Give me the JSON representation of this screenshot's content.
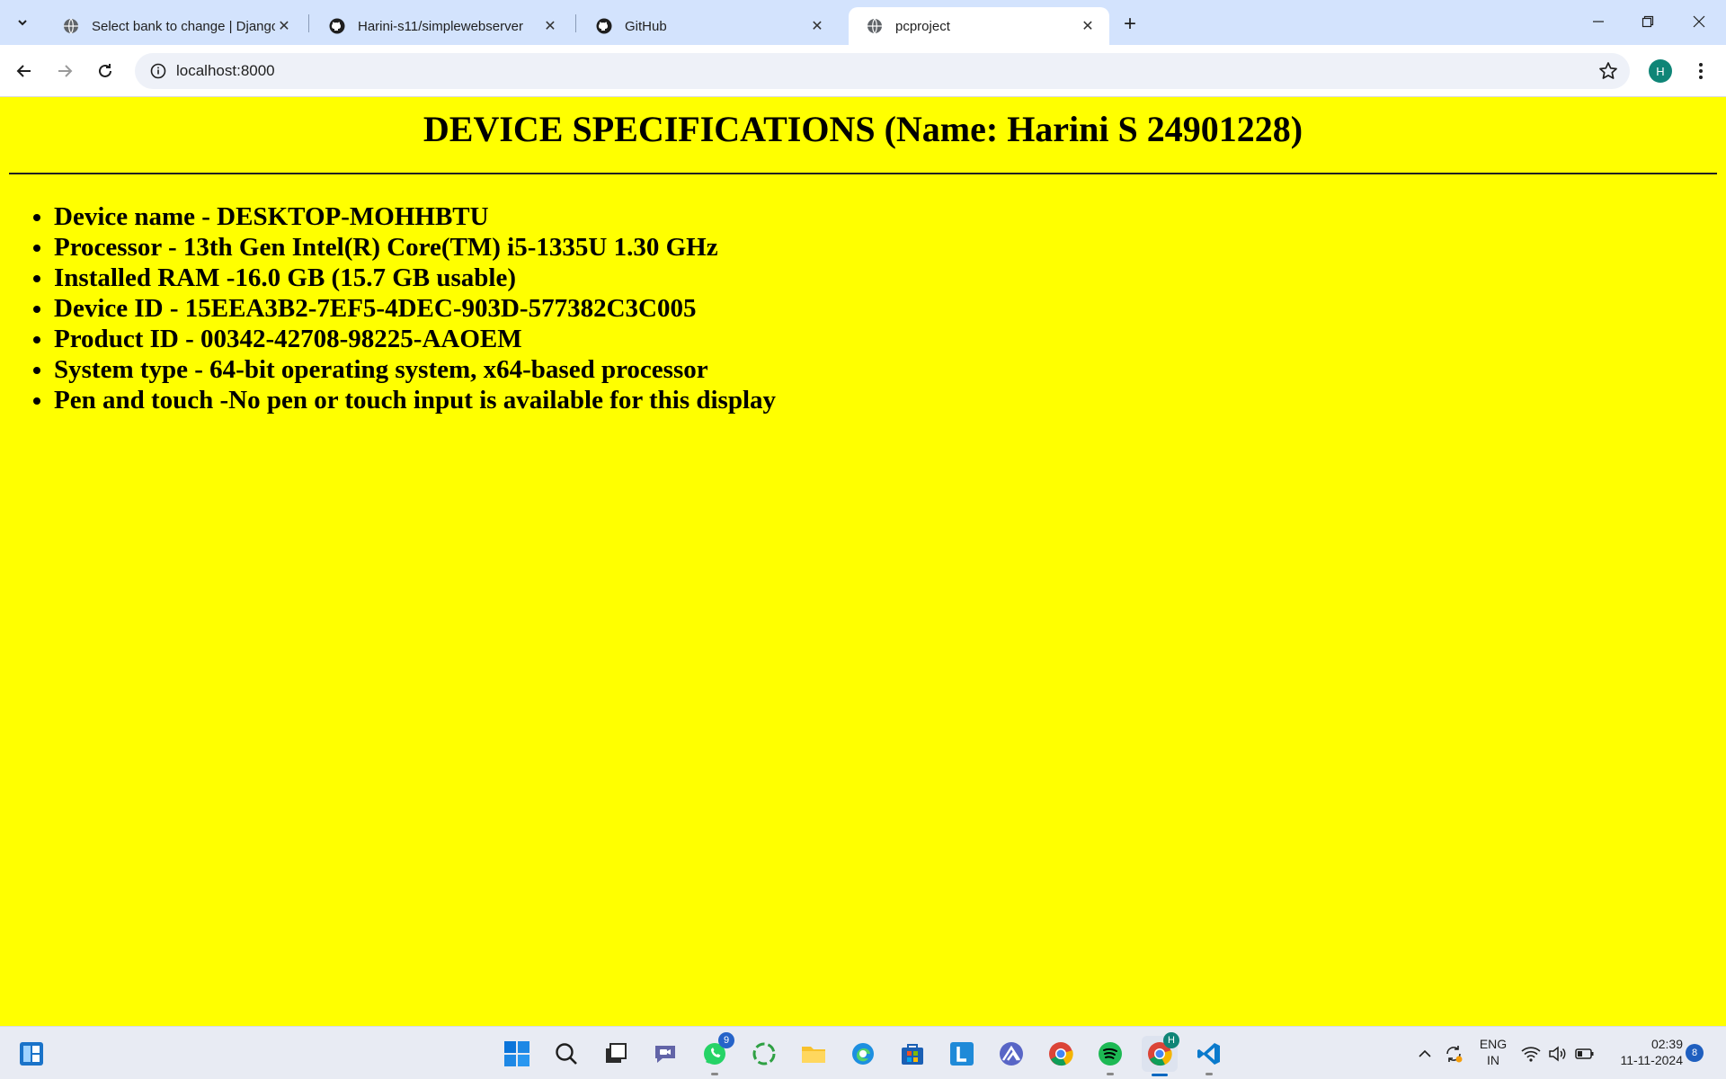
{
  "browser": {
    "tabs": [
      {
        "title": "Select bank to change | Django",
        "favicon": "globe-icon",
        "active": false
      },
      {
        "title": "Harini-s11/simplewebserver",
        "favicon": "github-icon",
        "active": false
      },
      {
        "title": "GitHub",
        "favicon": "github-icon",
        "active": false
      },
      {
        "title": "pcproject",
        "favicon": "globe-icon",
        "active": true
      }
    ],
    "url": "localhost:8000",
    "profile_initial": "H"
  },
  "page": {
    "heading": "DEVICE SPECIFICATIONS (Name: Harini S 24901228)",
    "specs": [
      "Device name - DESKTOP-MOHHBTU",
      "Processor - 13th Gen Intel(R) Core(TM) i5-1335U 1.30 GHz",
      "Installed RAM -16.0 GB (15.7 GB usable)",
      "Device ID - 15EEA3B2-7EF5-4DEC-903D-577382C3C005",
      "Product ID - 00342-42708-98225-AAOEM",
      "System type - 64-bit operating system, x64-based processor",
      "Pen and touch -No pen or touch input is available for this display"
    ],
    "background_color": "#ffff00"
  },
  "taskbar": {
    "whatsapp_badge": "9",
    "chrome_profile_badge": "H",
    "language_primary": "ENG",
    "language_secondary": "IN",
    "time": "02:39",
    "date": "11-11-2024",
    "notification_count": "8"
  },
  "colors": {
    "tabstrip": "#d3e3fd",
    "accent": "#0067c0",
    "profile": "#0f8577"
  }
}
